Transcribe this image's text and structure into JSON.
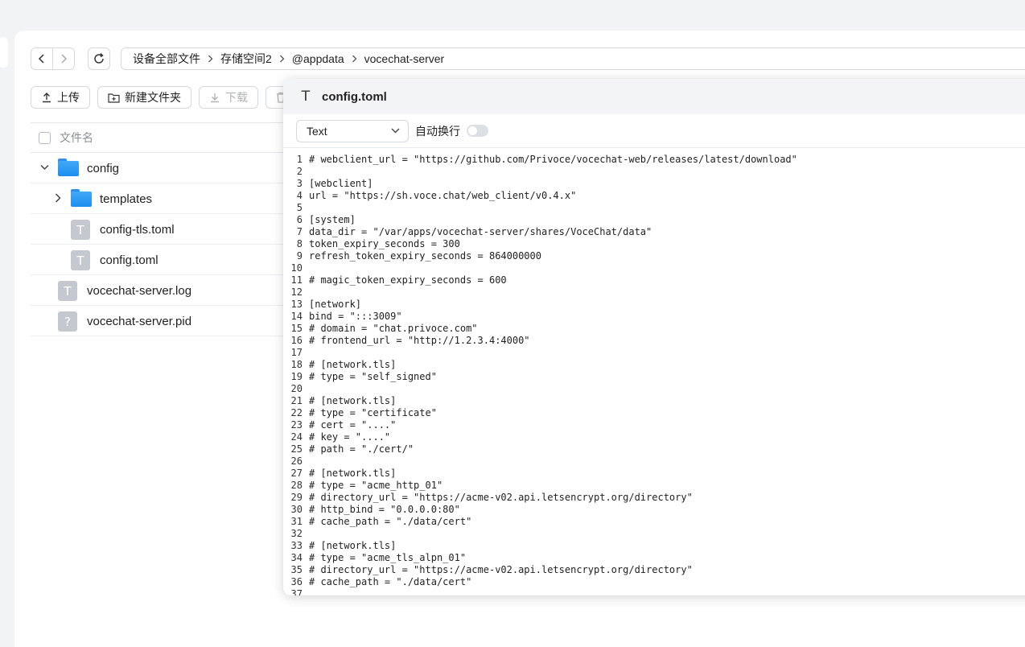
{
  "breadcrumb": [
    "设备全部文件",
    "存储空间2",
    "@appdata",
    "vocechat-server"
  ],
  "toolbar": {
    "upload": "上传",
    "new_folder": "新建文件夹",
    "download": "下载"
  },
  "table": {
    "header_name": "文件名"
  },
  "files": [
    {
      "name": "config",
      "type": "folder",
      "expanded": true
    },
    {
      "name": "templates",
      "type": "folder",
      "expanded": false
    },
    {
      "name": "config-tls.toml",
      "type": "text"
    },
    {
      "name": "config.toml",
      "type": "text"
    },
    {
      "name": "vocechat-server.log",
      "type": "text"
    },
    {
      "name": "vocechat-server.pid",
      "type": "unknown"
    }
  ],
  "editor": {
    "filename": "config.toml",
    "syntax": "Text",
    "wrap_label": "自动换行",
    "wrap_enabled": false,
    "lines": [
      "# webclient_url = \"https://github.com/Privoce/vocechat-web/releases/latest/download\"",
      "",
      "[webclient]",
      "url = \"https://sh.voce.chat/web_client/v0.4.x\"",
      "",
      "[system]",
      "data_dir = \"/var/apps/vocechat-server/shares/VoceChat/data\"",
      "token_expiry_seconds = 300",
      "refresh_token_expiry_seconds = 864000000",
      "",
      "# magic_token_expiry_seconds = 600",
      "",
      "[network]",
      "bind = \":::3009\"",
      "# domain = \"chat.privoce.com\"",
      "# frontend_url = \"http://1.2.3.4:4000\"",
      "",
      "# [network.tls]",
      "# type = \"self_signed\"",
      "",
      "# [network.tls]",
      "# type = \"certificate\"",
      "# cert = \"....\"",
      "# key = \"....\"",
      "# path = \"./cert/\"",
      "",
      "# [network.tls]",
      "# type = \"acme_http_01\"",
      "# directory_url = \"https://acme-v02.api.letsencrypt.org/directory\"",
      "# http_bind = \"0.0.0.0:80\"",
      "# cache_path = \"./data/cert\"",
      "",
      "# [network.tls]",
      "# type = \"acme_tls_alpn_01\"",
      "# directory_url = \"https://acme-v02.api.letsencrypt.org/directory\"",
      "# cache_path = \"./data/cert\"",
      ""
    ]
  },
  "colors": {
    "folder": "#1c8ef0",
    "file_icon": "#c5c9cf",
    "border": "#d6d9de"
  }
}
